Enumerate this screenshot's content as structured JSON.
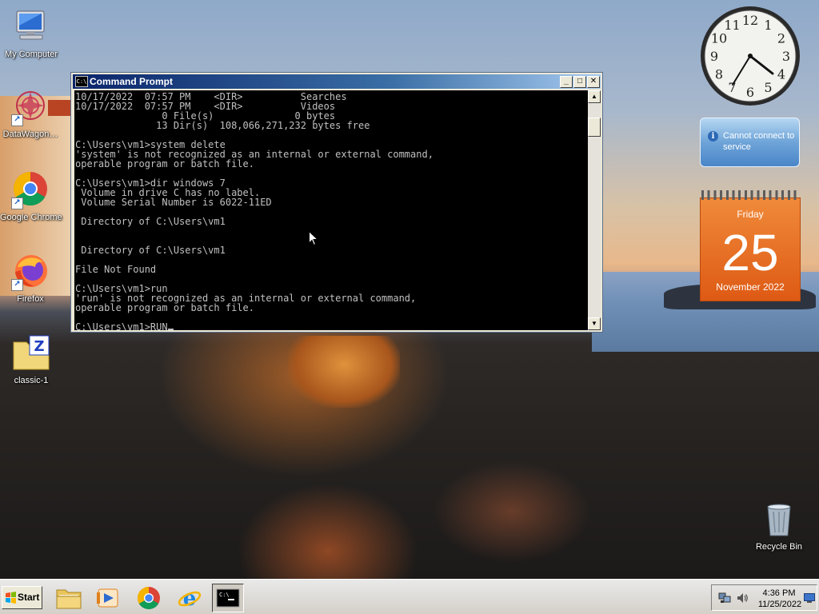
{
  "desktop": {
    "icons": [
      {
        "label": "My Computer",
        "icon": "my-computer-icon"
      },
      {
        "label": "DataWagon…",
        "icon": "datawagon-icon"
      },
      {
        "label": "Google Chrome",
        "icon": "chrome-icon"
      },
      {
        "label": "Firefox",
        "icon": "firefox-icon"
      },
      {
        "label": "classic-1",
        "icon": "zipped-folder-icon"
      },
      {
        "label": "Recycle Bin",
        "icon": "recycle-bin-icon"
      }
    ]
  },
  "cmd": {
    "title": "Command Prompt",
    "lines": [
      "10/17/2022  07:57 PM    <DIR>          Searches",
      "10/17/2022  07:57 PM    <DIR>          Videos",
      "               0 File(s)              0 bytes",
      "              13 Dir(s)  108,066,271,232 bytes free",
      "",
      "C:\\Users\\vm1>system delete",
      "'system' is not recognized as an internal or external command,",
      "operable program or batch file.",
      "",
      "C:\\Users\\vm1>dir windows 7",
      " Volume in drive C has no label.",
      " Volume Serial Number is 6022-11ED",
      "",
      " Directory of C:\\Users\\vm1",
      "",
      "",
      " Directory of C:\\Users\\vm1",
      "",
      "File Not Found",
      "",
      "C:\\Users\\vm1>run",
      "'run' is not recognized as an internal or external command,",
      "operable program or batch file.",
      ""
    ],
    "current_input": "C:\\Users\\vm1>RUN",
    "buttons": {
      "minimize": "_",
      "maximize": "□",
      "close": "✕"
    }
  },
  "gadgets": {
    "clock": {
      "numerals": [
        "12",
        "1",
        "2",
        "3",
        "4",
        "5",
        "6",
        "7",
        "8",
        "9",
        "10",
        "11"
      ]
    },
    "weather": {
      "message": "Cannot connect to service"
    },
    "calendar": {
      "weekday": "Friday",
      "day": "25",
      "month_year": "November 2022"
    }
  },
  "taskbar": {
    "start_label": "Start",
    "items": [
      {
        "name": "file-explorer",
        "icon": "folder-icon"
      },
      {
        "name": "media-player",
        "icon": "media-player-icon"
      },
      {
        "name": "google-chrome",
        "icon": "chrome-icon"
      },
      {
        "name": "internet-explorer",
        "icon": "ie-icon"
      },
      {
        "name": "command-prompt",
        "icon": "cmd-icon",
        "active": true
      }
    ],
    "tray": {
      "time": "4:36 PM",
      "date": "11/25/2022"
    }
  },
  "colors": {
    "console_bg": "#000000",
    "console_fg": "#c0c0c0",
    "title_active": "#0a246a",
    "calendar": "#e8661e"
  }
}
